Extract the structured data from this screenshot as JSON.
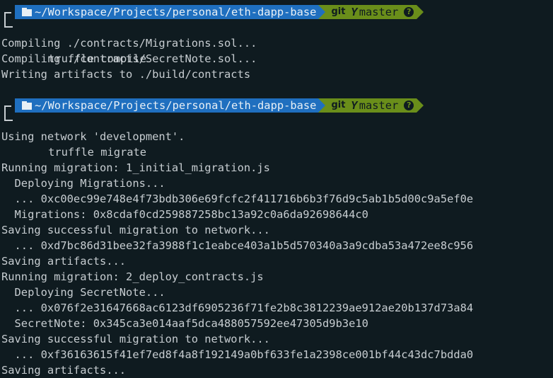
{
  "colors": {
    "background": "#0f1b20",
    "text": "#c7cdd1",
    "path_segment": "#1f6fbf",
    "git_segment": "#6a8e1a"
  },
  "block1": {
    "prompt": {
      "path": "~/Workspace/Projects/personal/eth-dapp-base",
      "git_label": "git",
      "branch_icon": "Y",
      "branch": "master",
      "status_icon": "?"
    },
    "command": "truffle compile",
    "output": [
      "Compiling ./contracts/Migrations.sol...",
      "Compiling ./contracts/SecretNote.sol...",
      "Writing artifacts to ./build/contracts"
    ]
  },
  "block2": {
    "prompt": {
      "path": "~/Workspace/Projects/personal/eth-dapp-base",
      "git_label": "git",
      "branch_icon": "Y",
      "branch": "master",
      "status_icon": "?"
    },
    "command": "truffle migrate",
    "output": [
      "Using network 'development'.",
      "",
      "Running migration: 1_initial_migration.js",
      "  Deploying Migrations...",
      "  ... 0xc00ec99e748e4f73bdb306e69fcfc2f411716b6b3f76d9c5ab1b5d00c9a5ef0e",
      "  Migrations: 0x8cdaf0cd259887258bc13a92c0a6da92698644c0",
      "Saving successful migration to network...",
      "  ... 0xd7bc86d31bee32fa3988f1c1eabce403a1b5d570340a3a9cdba53a472ee8c956",
      "Saving artifacts...",
      "Running migration: 2_deploy_contracts.js",
      "  Deploying SecretNote...",
      "  ... 0x076f2e31647668ac6123df6905236f71fe2b8c3812239ae912ae20b137d73a84",
      "  SecretNote: 0x345ca3e014aaf5dca488057592ee47305d9b3e10",
      "Saving successful migration to network...",
      "  ... 0xf36163615f41ef7ed8f4a8f192149a0bf633fe1a2398ce001bf44c43dc7bdda0",
      "Saving artifacts..."
    ]
  }
}
